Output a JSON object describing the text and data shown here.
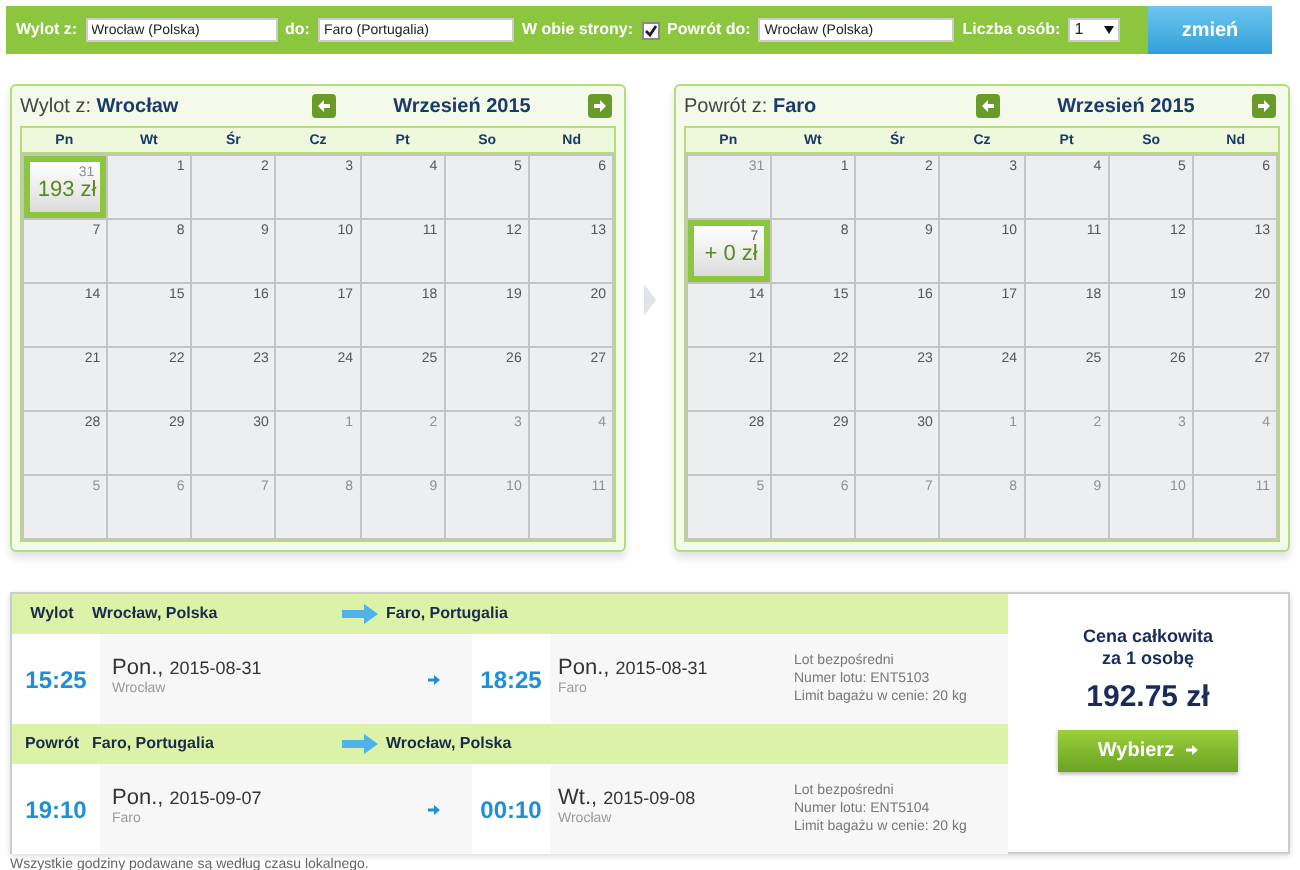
{
  "search_bar": {
    "from_label": "Wylot z:",
    "from_value": "Wrocław (Polska)",
    "to_label": "do:",
    "to_value": "Faro (Portugalia)",
    "roundtrip_label": "W obie strony:",
    "roundtrip_checked": true,
    "return_label": "Powrót do:",
    "return_value": "Wrocław (Polska)",
    "persons_label": "Liczba osób:",
    "persons_value": "1",
    "submit": "zmień"
  },
  "calendars": [
    {
      "title_prefix": "Wylot z:",
      "title_city": "Wrocław",
      "month": "Wrzesień 2015",
      "weekdays": [
        "Pn",
        "Wt",
        "Śr",
        "Cz",
        "Pt",
        "So",
        "Nd"
      ],
      "weeks": [
        [
          {
            "day": "31",
            "outside": true,
            "selected": true,
            "price": "193 zł"
          },
          {
            "day": "1",
            "outside": false,
            "selected": false
          },
          {
            "day": "2",
            "outside": false,
            "selected": false
          },
          {
            "day": "3",
            "outside": false,
            "selected": false
          },
          {
            "day": "4",
            "outside": false,
            "selected": false
          },
          {
            "day": "5",
            "outside": false,
            "selected": false
          },
          {
            "day": "6",
            "outside": false,
            "selected": false
          }
        ],
        [
          {
            "day": "7",
            "outside": false,
            "selected": false
          },
          {
            "day": "8",
            "outside": false,
            "selected": false
          },
          {
            "day": "9",
            "outside": false,
            "selected": false
          },
          {
            "day": "10",
            "outside": false,
            "selected": false
          },
          {
            "day": "11",
            "outside": false,
            "selected": false
          },
          {
            "day": "12",
            "outside": false,
            "selected": false
          },
          {
            "day": "13",
            "outside": false,
            "selected": false
          }
        ],
        [
          {
            "day": "14",
            "outside": false,
            "selected": false
          },
          {
            "day": "15",
            "outside": false,
            "selected": false
          },
          {
            "day": "16",
            "outside": false,
            "selected": false
          },
          {
            "day": "17",
            "outside": false,
            "selected": false
          },
          {
            "day": "18",
            "outside": false,
            "selected": false
          },
          {
            "day": "19",
            "outside": false,
            "selected": false
          },
          {
            "day": "20",
            "outside": false,
            "selected": false
          }
        ],
        [
          {
            "day": "21",
            "outside": false,
            "selected": false
          },
          {
            "day": "22",
            "outside": false,
            "selected": false
          },
          {
            "day": "23",
            "outside": false,
            "selected": false
          },
          {
            "day": "24",
            "outside": false,
            "selected": false
          },
          {
            "day": "25",
            "outside": false,
            "selected": false
          },
          {
            "day": "26",
            "outside": false,
            "selected": false
          },
          {
            "day": "27",
            "outside": false,
            "selected": false
          }
        ],
        [
          {
            "day": "28",
            "outside": false,
            "selected": false
          },
          {
            "day": "29",
            "outside": false,
            "selected": false
          },
          {
            "day": "30",
            "outside": false,
            "selected": false
          },
          {
            "day": "1",
            "outside": true,
            "selected": false
          },
          {
            "day": "2",
            "outside": true,
            "selected": false
          },
          {
            "day": "3",
            "outside": true,
            "selected": false
          },
          {
            "day": "4",
            "outside": true,
            "selected": false
          }
        ],
        [
          {
            "day": "5",
            "outside": true,
            "selected": false
          },
          {
            "day": "6",
            "outside": true,
            "selected": false
          },
          {
            "day": "7",
            "outside": true,
            "selected": false
          },
          {
            "day": "8",
            "outside": true,
            "selected": false
          },
          {
            "day": "9",
            "outside": true,
            "selected": false
          },
          {
            "day": "10",
            "outside": true,
            "selected": false
          },
          {
            "day": "11",
            "outside": true,
            "selected": false
          }
        ]
      ]
    },
    {
      "title_prefix": "Powrót z:",
      "title_city": "Faro",
      "month": "Wrzesień 2015",
      "weekdays": [
        "Pn",
        "Wt",
        "Śr",
        "Cz",
        "Pt",
        "So",
        "Nd"
      ],
      "weeks": [
        [
          {
            "day": "31",
            "outside": true,
            "selected": false
          },
          {
            "day": "1",
            "outside": false,
            "selected": false
          },
          {
            "day": "2",
            "outside": false,
            "selected": false
          },
          {
            "day": "3",
            "outside": false,
            "selected": false
          },
          {
            "day": "4",
            "outside": false,
            "selected": false
          },
          {
            "day": "5",
            "outside": false,
            "selected": false
          },
          {
            "day": "6",
            "outside": false,
            "selected": false
          }
        ],
        [
          {
            "day": "7",
            "outside": false,
            "selected": true,
            "price": "+ 0 zł"
          },
          {
            "day": "8",
            "outside": false,
            "selected": false
          },
          {
            "day": "9",
            "outside": false,
            "selected": false
          },
          {
            "day": "10",
            "outside": false,
            "selected": false
          },
          {
            "day": "11",
            "outside": false,
            "selected": false
          },
          {
            "day": "12",
            "outside": false,
            "selected": false
          },
          {
            "day": "13",
            "outside": false,
            "selected": false
          }
        ],
        [
          {
            "day": "14",
            "outside": false,
            "selected": false
          },
          {
            "day": "15",
            "outside": false,
            "selected": false
          },
          {
            "day": "16",
            "outside": false,
            "selected": false
          },
          {
            "day": "17",
            "outside": false,
            "selected": false
          },
          {
            "day": "18",
            "outside": false,
            "selected": false
          },
          {
            "day": "19",
            "outside": false,
            "selected": false
          },
          {
            "day": "20",
            "outside": false,
            "selected": false
          }
        ],
        [
          {
            "day": "21",
            "outside": false,
            "selected": false
          },
          {
            "day": "22",
            "outside": false,
            "selected": false
          },
          {
            "day": "23",
            "outside": false,
            "selected": false
          },
          {
            "day": "24",
            "outside": false,
            "selected": false
          },
          {
            "day": "25",
            "outside": false,
            "selected": false
          },
          {
            "day": "26",
            "outside": false,
            "selected": false
          },
          {
            "day": "27",
            "outside": false,
            "selected": false
          }
        ],
        [
          {
            "day": "28",
            "outside": false,
            "selected": false
          },
          {
            "day": "29",
            "outside": false,
            "selected": false
          },
          {
            "day": "30",
            "outside": false,
            "selected": false
          },
          {
            "day": "1",
            "outside": true,
            "selected": false
          },
          {
            "day": "2",
            "outside": true,
            "selected": false
          },
          {
            "day": "3",
            "outside": true,
            "selected": false
          },
          {
            "day": "4",
            "outside": true,
            "selected": false
          }
        ],
        [
          {
            "day": "5",
            "outside": true,
            "selected": false
          },
          {
            "day": "6",
            "outside": true,
            "selected": false
          },
          {
            "day": "7",
            "outside": true,
            "selected": false
          },
          {
            "day": "8",
            "outside": true,
            "selected": false
          },
          {
            "day": "9",
            "outside": true,
            "selected": false
          },
          {
            "day": "10",
            "outside": true,
            "selected": false
          },
          {
            "day": "11",
            "outside": true,
            "selected": false
          }
        ]
      ]
    }
  ],
  "flights": [
    {
      "label": "Wylot",
      "from": "Wrocław, Polska",
      "to": "Faro, Portugalia",
      "dep_time": "15:25",
      "dep_day": "Pon.,",
      "dep_date": "2015-08-31",
      "dep_city": "Wrocław",
      "arr_time": "18:25",
      "arr_day": "Pon.,",
      "arr_date": "2015-08-31",
      "arr_city": "Faro",
      "info": [
        "Lot bezpośredni",
        "Numer lotu: ENT5103",
        "Limit bagażu w cenie: 20 kg"
      ]
    },
    {
      "label": "Powrót",
      "from": "Faro, Portugalia",
      "to": "Wrocław, Polska",
      "dep_time": "19:10",
      "dep_day": "Pon.,",
      "dep_date": "2015-09-07",
      "dep_city": "Faro",
      "arr_time": "00:10",
      "arr_day": "Wt.,",
      "arr_date": "2015-09-08",
      "arr_city": "Wrocław",
      "info": [
        "Lot bezpośredni",
        "Numer lotu: ENT5104",
        "Limit bagażu w cenie: 20 kg"
      ]
    }
  ],
  "price": {
    "label_line1": "Cena całkowita",
    "label_line2": "za 1 osobę",
    "amount": "192.75 zł",
    "button": "Wybierz"
  },
  "footnote": "Wszystkie godziny podawane są według czasu lokalnego."
}
